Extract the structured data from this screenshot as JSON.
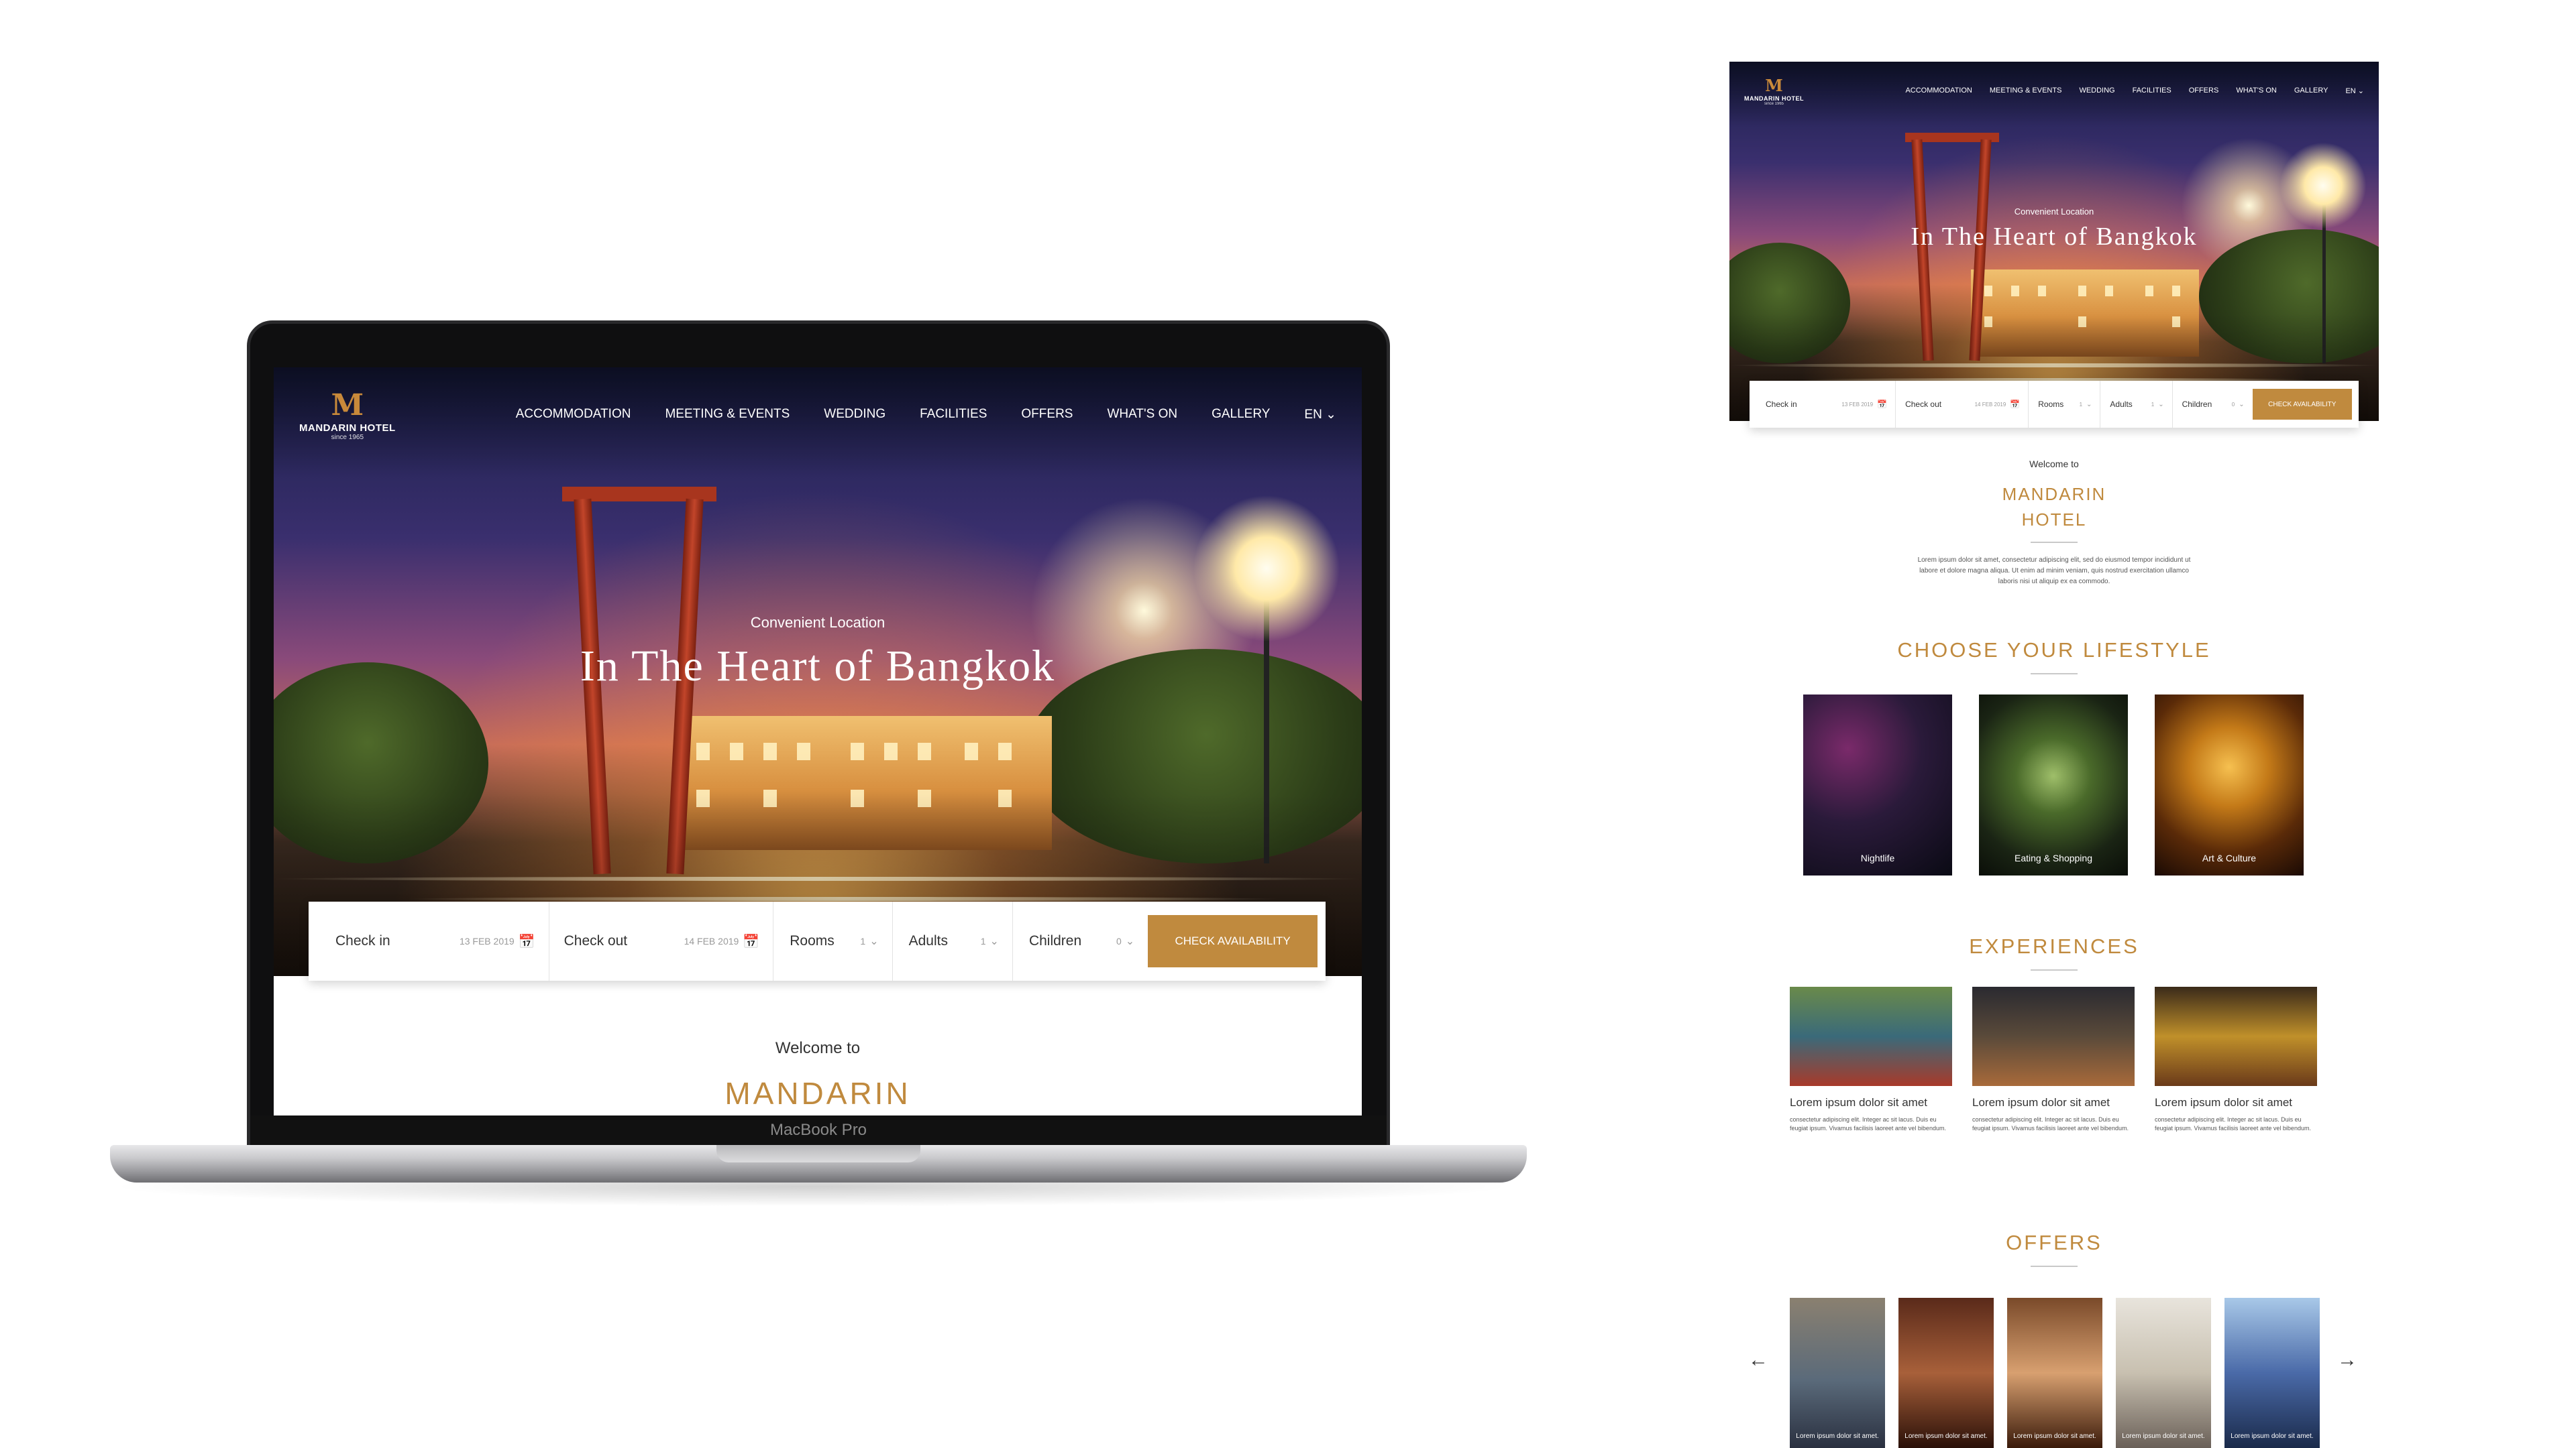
{
  "brand": {
    "mark": "M",
    "name": "MANDARIN HOTEL",
    "since": "since 1965",
    "accent_color": "#c08a3e"
  },
  "nav": {
    "items": [
      "ACCOMMODATION",
      "MEETING & EVENTS",
      "WEDDING",
      "FACILITIES",
      "OFFERS",
      "WHAT'S ON",
      "GALLERY"
    ],
    "language": "EN",
    "language_icon": "chevron-down-icon"
  },
  "hero": {
    "subtitle": "Convenient Location",
    "title": "In The Heart of Bangkok"
  },
  "booking": {
    "check_in_label": "Check in",
    "check_in_value": "13 FEB 2019",
    "check_out_label": "Check out",
    "check_out_value": "14 FEB 2019",
    "rooms_label": "Rooms",
    "rooms_value": "1",
    "adults_label": "Adults",
    "adults_value": "1",
    "children_label": "Children",
    "children_value": "0",
    "button_label": "CHECK AVAILABILITY",
    "calendar_icon": "calendar-icon"
  },
  "welcome": {
    "intro": "Welcome to",
    "title_line1": "MANDARIN",
    "title_line2": "HOTEL",
    "body": "Lorem ipsum dolor sit amet, consectetur adipiscing elit, sed do eiusmod tempor incididunt ut labore et dolore magna aliqua. Ut enim ad minim veniam, quis nostrud exercitation ullamco laboris nisi ut aliquip ex ea commodo."
  },
  "lifestyle": {
    "heading": "CHOOSE YOUR LIFESTYLE",
    "cards": [
      {
        "label": "Nightlife"
      },
      {
        "label": "Eating & Shopping"
      },
      {
        "label": "Art & Culture"
      }
    ]
  },
  "experiences": {
    "heading": "EXPERIENCES",
    "cards": [
      {
        "title": "Lorem ipsum dolor sit amet",
        "body": "consectetur adipiscing elit. Integer ac sit lacus. Duis eu feugiat ipsum. Vivamus facilisis laoreet ante vel bibendum."
      },
      {
        "title": "Lorem ipsum dolor sit amet",
        "body": "consectetur adipiscing elit. Integer ac sit lacus. Duis eu feugiat ipsum. Vivamus facilisis laoreet ante vel bibendum."
      },
      {
        "title": "Lorem ipsum dolor sit amet",
        "body": "consectetur adipiscing elit. Integer ac sit lacus. Duis eu feugiat ipsum. Vivamus facilisis laoreet ante vel bibendum."
      }
    ]
  },
  "offers": {
    "heading": "OFFERS",
    "prev_icon": "arrow-left-icon",
    "next_icon": "arrow-right-icon",
    "cards": [
      {
        "label": "Lorem ipsum dolor sit amet."
      },
      {
        "label": "Lorem ipsum dolor sit amet."
      },
      {
        "label": "Lorem ipsum dolor sit amet."
      },
      {
        "label": "Lorem ipsum dolor sit amet."
      },
      {
        "label": "Lorem ipsum dolor sit amet."
      }
    ]
  },
  "laptop": {
    "model_label": "MacBook Pro"
  }
}
